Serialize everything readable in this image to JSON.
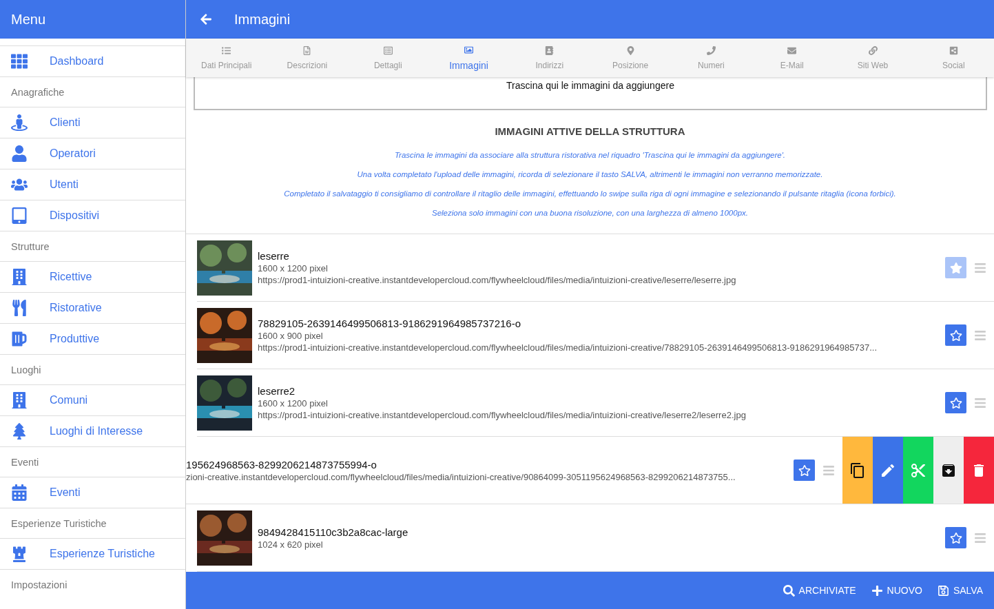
{
  "menu": {
    "title": "Menu"
  },
  "sidebar": {
    "items": [
      {
        "kind": "link",
        "label": "Dashboard"
      },
      {
        "kind": "section",
        "label": "Anagrafiche"
      },
      {
        "kind": "link",
        "label": "Clienti"
      },
      {
        "kind": "link",
        "label": "Operatori"
      },
      {
        "kind": "link",
        "label": "Utenti"
      },
      {
        "kind": "link",
        "label": "Dispositivi"
      },
      {
        "kind": "section",
        "label": "Strutture"
      },
      {
        "kind": "link",
        "label": "Ricettive"
      },
      {
        "kind": "link",
        "label": "Ristorative"
      },
      {
        "kind": "link",
        "label": "Produttive"
      },
      {
        "kind": "section",
        "label": "Luoghi"
      },
      {
        "kind": "link",
        "label": "Comuni"
      },
      {
        "kind": "link",
        "label": "Luoghi di Interesse"
      },
      {
        "kind": "section",
        "label": "Eventi"
      },
      {
        "kind": "link",
        "label": "Eventi"
      },
      {
        "kind": "section",
        "label": "Esperienze Turistiche"
      },
      {
        "kind": "link",
        "label": "Esperienze Turistiche"
      },
      {
        "kind": "section",
        "label": "Impostazioni"
      }
    ]
  },
  "header": {
    "title": "Immagini"
  },
  "tabs": [
    {
      "label": "Dati Principali",
      "selected": false
    },
    {
      "label": "Descrizioni",
      "selected": false
    },
    {
      "label": "Dettagli",
      "selected": false
    },
    {
      "label": "Immagini",
      "selected": true
    },
    {
      "label": "Indirizzi",
      "selected": false
    },
    {
      "label": "Posizione",
      "selected": false
    },
    {
      "label": "Numeri",
      "selected": false
    },
    {
      "label": "E-Mail",
      "selected": false
    },
    {
      "label": "Siti Web",
      "selected": false
    },
    {
      "label": "Social",
      "selected": false
    }
  ],
  "dropzone": {
    "text": "Trascina qui le immagini da aggiungere"
  },
  "section": {
    "heading": "IMMAGINI ATTIVE DELLA STRUTTURA",
    "notes": [
      "Trascina le immagini da associare alla struttura ristorativa nel riquadro 'Trascina qui le immagini da aggiungere'.",
      "Una volta completato l'upload delle immagini, ricorda di selezionare il tasto SALVA, altrimenti le immagini non verranno memorizzate.",
      "Completato il salvataggio ti consigliamo di controllare il ritaglio delle immagini, effettuando lo swipe sulla riga di ogni immagine e selezionando il pulsante ritaglia (icona forbici).",
      "Seleziona solo immagini con una buona risoluzione, con una larghezza di almeno 1000px."
    ]
  },
  "images": [
    {
      "swiped": false,
      "starred": true,
      "title": "leserre",
      "size": "1600 x 1200 pixel",
      "url": "https://prod1-intuizioni-creative.instantdevelopercloud.com/flywheelcloud/files/media/intuizioni-creative/leserre/leserre.jpg"
    },
    {
      "swiped": false,
      "starred": false,
      "title": "78829105-2639146499506813-9186291964985737216-o",
      "size": "1600 x 900 pixel",
      "url": "https://prod1-intuizioni-creative.instantdevelopercloud.com/flywheelcloud/files/media/intuizioni-creative/78829105-2639146499506813-9186291964985737..."
    },
    {
      "swiped": false,
      "starred": false,
      "title": "leserre2",
      "size": "1600 x 1200 pixel",
      "url": "https://prod1-intuizioni-creative.instantdevelopercloud.com/flywheelcloud/files/media/intuizioni-creative/leserre2/leserre2.jpg"
    },
    {
      "swiped": true,
      "starred": false,
      "title": "195624968563-8299206214873755994-o",
      "url": "zioni-creative.instantdevelopercloud.com/flywheelcloud/files/media/intuizioni-creative/90864099-3051195624968563-8299206214873755...",
      "actions": [
        {
          "kind": "copy",
          "color": "#ffb83d"
        },
        {
          "kind": "edit",
          "color": "#3b73e8"
        },
        {
          "kind": "crop",
          "color": "#12d65e"
        },
        {
          "kind": "archive",
          "color": "#eeeeee"
        },
        {
          "kind": "delete",
          "color": "#f5263c"
        }
      ]
    },
    {
      "swiped": false,
      "starred": false,
      "title": "9849428415110c3b2a8cac-large",
      "size": "1024 x 620 pixel"
    }
  ],
  "footer": {
    "buttons": [
      {
        "kind": "search",
        "label": "ARCHIVIATE"
      },
      {
        "kind": "add",
        "label": "NUOVO"
      },
      {
        "kind": "save",
        "label": "SALVA"
      }
    ]
  }
}
